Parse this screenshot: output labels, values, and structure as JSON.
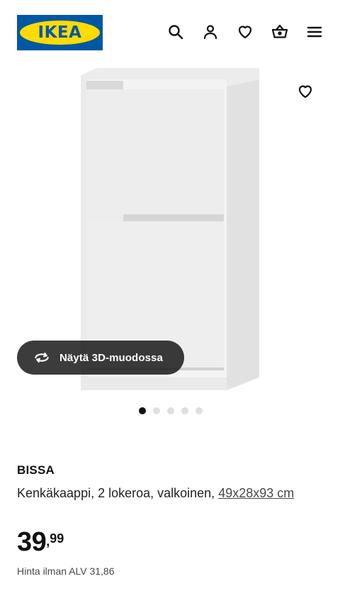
{
  "header": {
    "logo_text": "IKEA",
    "icons": [
      "search-icon",
      "account-icon",
      "heart-icon",
      "basket-icon",
      "menu-icon"
    ]
  },
  "gallery": {
    "image_name": "shoe-cabinet-image",
    "view3d_label": "Näytä 3D-muodossa",
    "active_index": 0,
    "total_images": 5
  },
  "product": {
    "name": "BISSA",
    "description": "Kenkäkaappi, 2 lokeroa, valkoinen,",
    "dimensions_link": "49x28x93",
    "dimensions_unit": "cm",
    "price_integer": "39",
    "price_separator": ",",
    "price_decimal": "99",
    "price_ex_vat": "Hinta ilman ALV 31,86"
  },
  "colors": {
    "brand_blue": "#0058a3",
    "brand_yellow": "#ffdb00",
    "text": "#111111",
    "muted": "#484848"
  }
}
